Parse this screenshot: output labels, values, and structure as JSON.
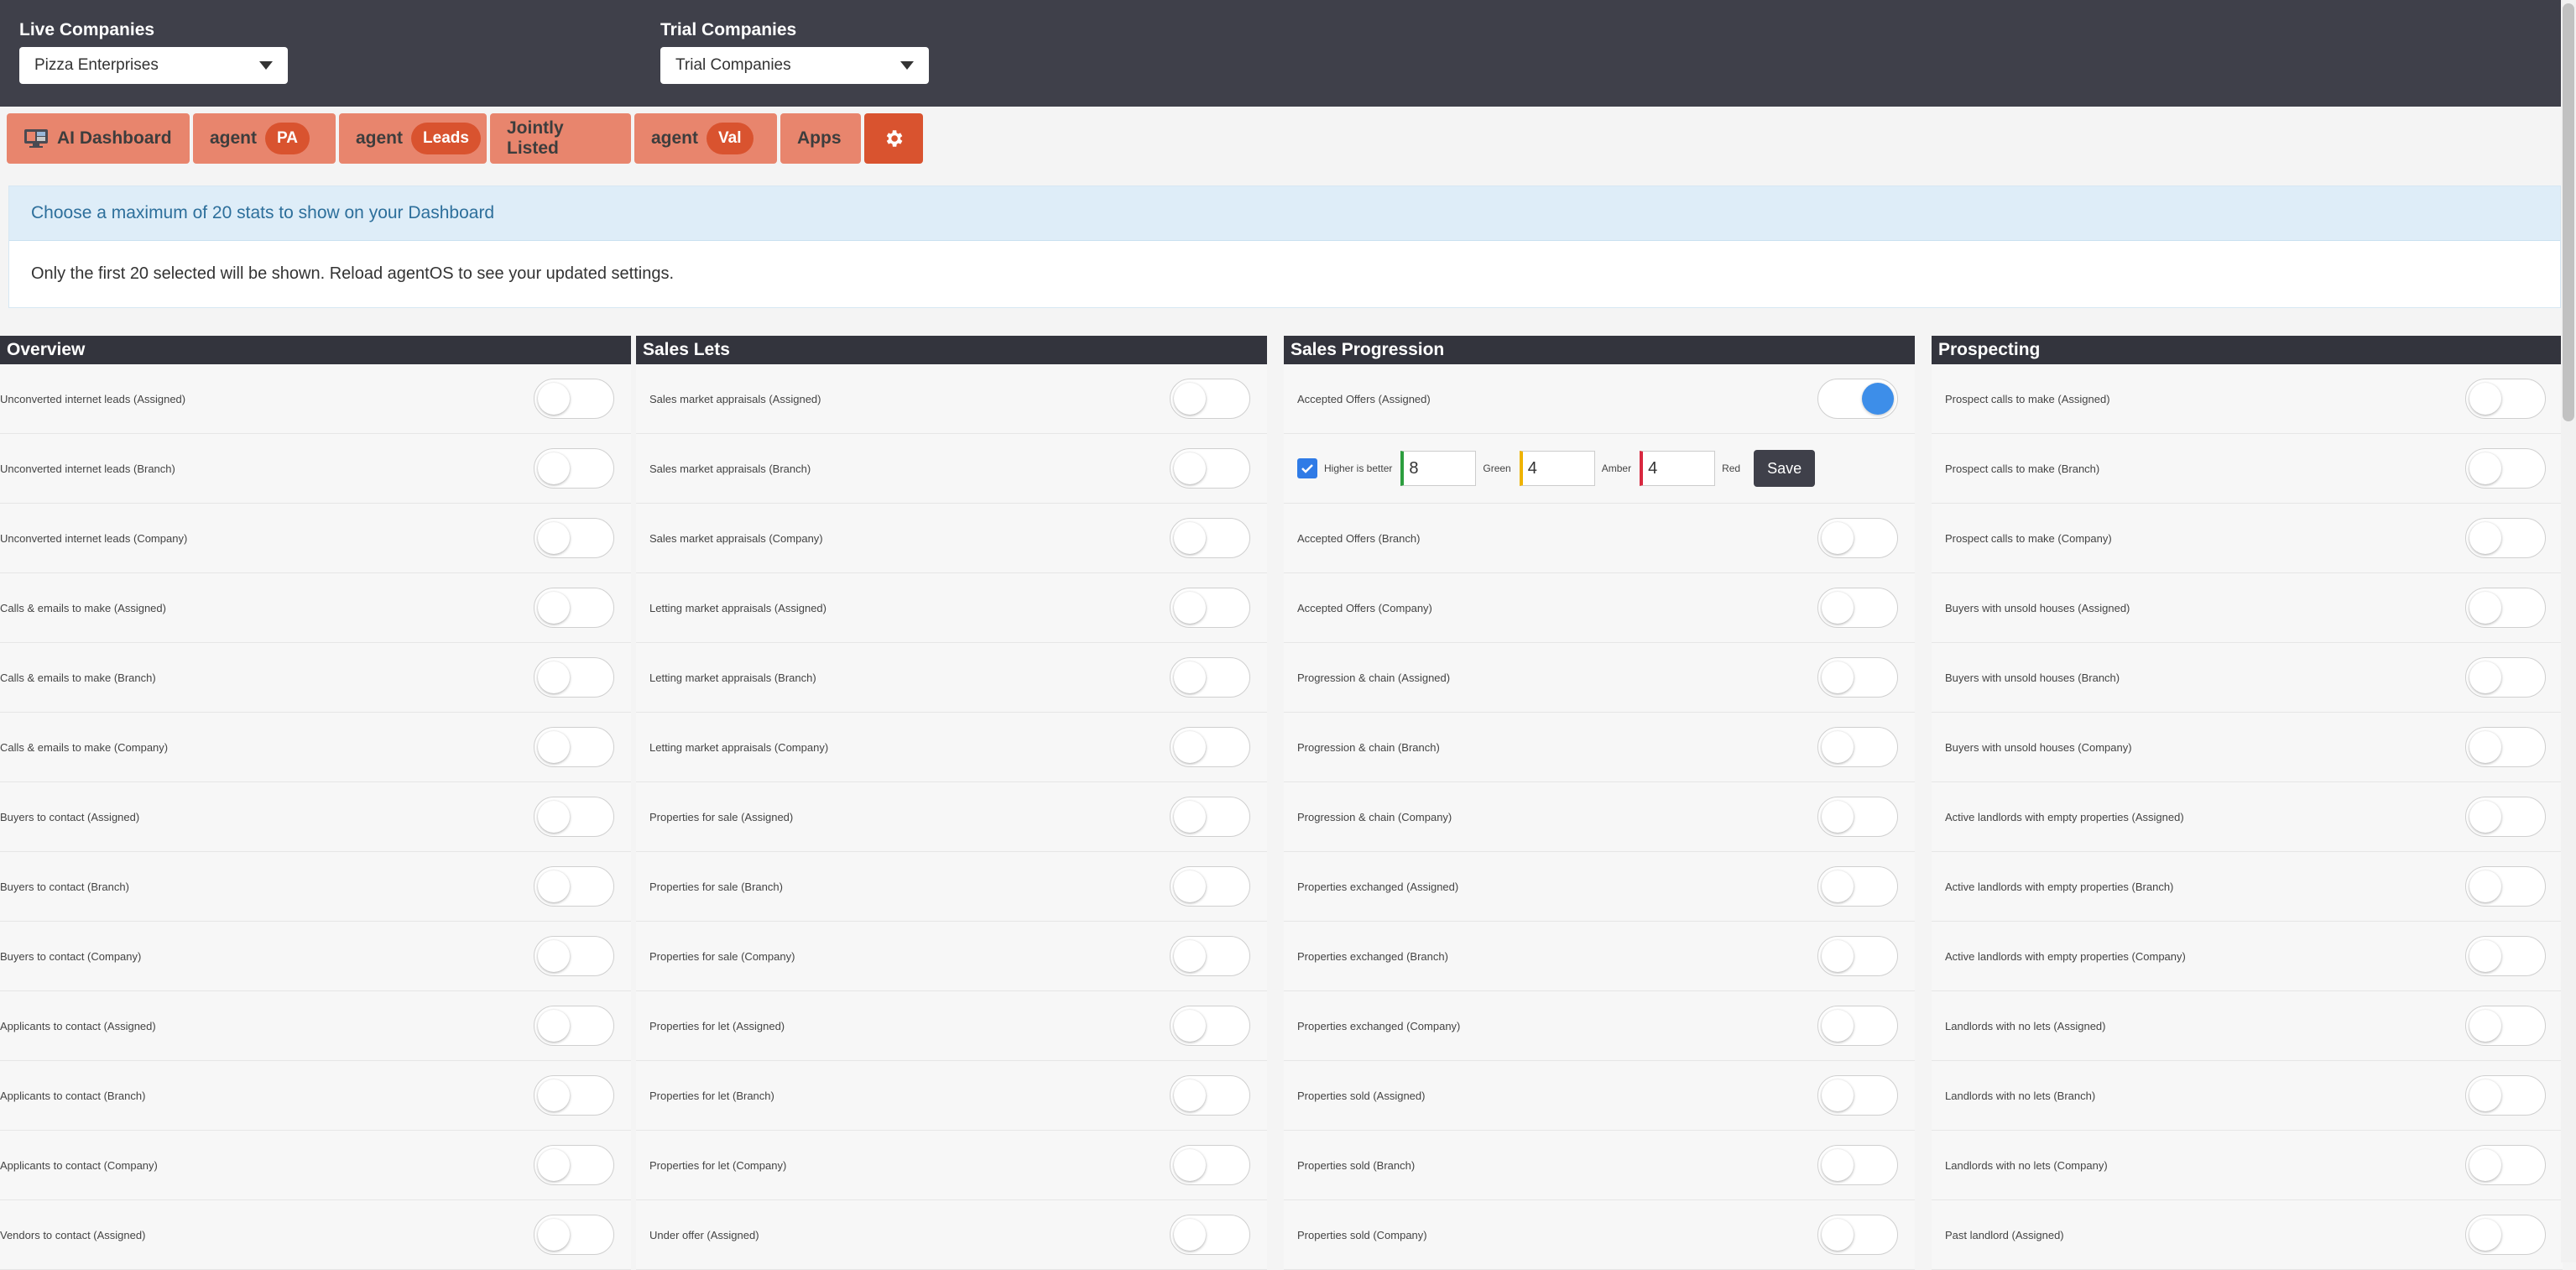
{
  "header": {
    "live_label": "Live Companies",
    "live_selected": "Pizza Enterprises",
    "trial_label": "Trial Companies",
    "trial_selected": "Trial Companies"
  },
  "tabs": [
    {
      "label": "AI Dashboard",
      "icon": "monitor-icon"
    },
    {
      "label": "agent",
      "pill": "PA"
    },
    {
      "label": "agent",
      "pill": "Leads"
    },
    {
      "label": "Jointly Listed"
    },
    {
      "label": "agent",
      "pill": "Val"
    },
    {
      "label": "Apps"
    },
    {
      "label": "",
      "icon": "gear-icon"
    }
  ],
  "info": {
    "heading": "Choose a maximum of 20 stats to show on your Dashboard",
    "body": "Only the first 20 selected will be shown. Reload agentOS to see your updated settings."
  },
  "threshold": {
    "checkbox_label": "Higher is better",
    "green_value": "8",
    "green_label": "Green",
    "amber_value": "4",
    "amber_label": "Amber",
    "red_value": "4",
    "red_label": "Red",
    "save_label": "Save"
  },
  "columns": [
    {
      "title": "Overview",
      "rows": [
        {
          "label": "Unconverted internet leads (Assigned)",
          "on": false
        },
        {
          "label": "Unconverted internet leads (Branch)",
          "on": false
        },
        {
          "label": "Unconverted internet leads (Company)",
          "on": false
        },
        {
          "label": "Calls & emails to make (Assigned)",
          "on": false
        },
        {
          "label": "Calls & emails to make (Branch)",
          "on": false
        },
        {
          "label": "Calls & emails to make (Company)",
          "on": false
        },
        {
          "label": "Buyers to contact (Assigned)",
          "on": false
        },
        {
          "label": "Buyers to contact (Branch)",
          "on": false
        },
        {
          "label": "Buyers to contact (Company)",
          "on": false
        },
        {
          "label": "Applicants to contact (Assigned)",
          "on": false
        },
        {
          "label": "Applicants to contact (Branch)",
          "on": false
        },
        {
          "label": "Applicants to contact (Company)",
          "on": false
        },
        {
          "label": "Vendors to contact (Assigned)",
          "on": false
        }
      ]
    },
    {
      "title": "Sales Lets",
      "rows": [
        {
          "label": "Sales market appraisals (Assigned)",
          "on": false
        },
        {
          "label": "Sales market appraisals (Branch)",
          "on": false
        },
        {
          "label": "Sales market appraisals (Company)",
          "on": false
        },
        {
          "label": "Letting market appraisals (Assigned)",
          "on": false
        },
        {
          "label": "Letting market appraisals (Branch)",
          "on": false
        },
        {
          "label": "Letting market appraisals (Company)",
          "on": false
        },
        {
          "label": "Properties for sale (Assigned)",
          "on": false
        },
        {
          "label": "Properties for sale (Branch)",
          "on": false
        },
        {
          "label": "Properties for sale (Company)",
          "on": false
        },
        {
          "label": "Properties for let (Assigned)",
          "on": false
        },
        {
          "label": "Properties for let (Branch)",
          "on": false
        },
        {
          "label": "Properties for let (Company)",
          "on": false
        },
        {
          "label": "Under offer (Assigned)",
          "on": false
        }
      ]
    },
    {
      "title": "Sales Progression",
      "rows": [
        {
          "label": "Accepted Offers (Assigned)",
          "on": true
        },
        {
          "label": "",
          "threshold": true
        },
        {
          "label": "Accepted Offers (Branch)",
          "on": false
        },
        {
          "label": "Accepted Offers (Company)",
          "on": false
        },
        {
          "label": "Progression & chain (Assigned)",
          "on": false
        },
        {
          "label": "Progression & chain (Branch)",
          "on": false
        },
        {
          "label": "Progression & chain (Company)",
          "on": false
        },
        {
          "label": "Properties exchanged (Assigned)",
          "on": false
        },
        {
          "label": "Properties exchanged (Branch)",
          "on": false
        },
        {
          "label": "Properties exchanged (Company)",
          "on": false
        },
        {
          "label": "Properties sold (Assigned)",
          "on": false
        },
        {
          "label": "Properties sold (Branch)",
          "on": false
        },
        {
          "label": "Properties sold (Company)",
          "on": false
        }
      ]
    },
    {
      "title": "Prospecting",
      "rows": [
        {
          "label": "Prospect calls to make (Assigned)",
          "on": false
        },
        {
          "label": "Prospect calls to make (Branch)",
          "on": false
        },
        {
          "label": "Prospect calls to make (Company)",
          "on": false
        },
        {
          "label": "Buyers with unsold houses (Assigned)",
          "on": false
        },
        {
          "label": "Buyers with unsold houses (Branch)",
          "on": false
        },
        {
          "label": "Buyers with unsold houses (Company)",
          "on": false
        },
        {
          "label": "Active landlords with empty properties (Assigned)",
          "on": false
        },
        {
          "label": "Active landlords with empty properties (Branch)",
          "on": false
        },
        {
          "label": "Active landlords with empty properties (Company)",
          "on": false
        },
        {
          "label": "Landlords with no lets (Assigned)",
          "on": false
        },
        {
          "label": "Landlords with no lets (Branch)",
          "on": false
        },
        {
          "label": "Landlords with no lets (Company)",
          "on": false
        },
        {
          "label": "Past landlord (Assigned)",
          "on": false
        }
      ]
    }
  ]
}
